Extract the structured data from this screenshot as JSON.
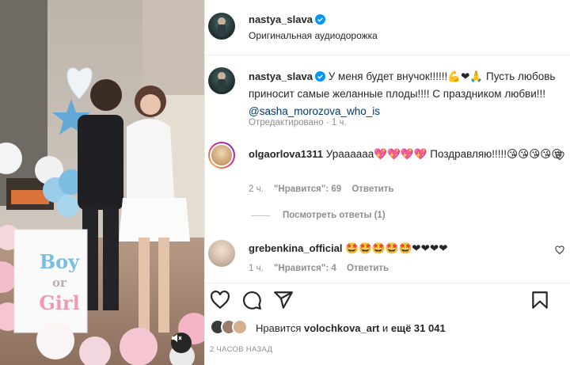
{
  "post": {
    "author": "nastya_slava",
    "audio": "Оригинальная аудиодорожка"
  },
  "caption": {
    "author": "nastya_slava",
    "text_1": "У меня будет внучок!!!!!!",
    "emojis_1": "💪❤🙏",
    "text_2": "Пусть любовь приносит самые желанные плоды!!!! С праздником любви!!!",
    "mention": "@sasha_morozova_who_is",
    "edited": "Отредактировано",
    "time": "1 ч."
  },
  "comments": [
    {
      "author": "olgaorlova1311",
      "text_before": "Ураааааа",
      "emojis_1": "💖💖💖💖",
      "text_after": "Поздравляю!!!!!",
      "emojis_2": "😘😘😘😘😘",
      "time": "2 ч.",
      "likes": "\"Нравится\": 69",
      "reply": "Ответить",
      "view_replies": "Посмотреть ответы (1)"
    },
    {
      "author": "grebenkina_official",
      "emojis": "🤩🤩🤩🤩🤩❤❤❤❤",
      "time": "1 ч.",
      "likes": "\"Нравится\": 4",
      "reply": "Ответить"
    }
  ],
  "likes": {
    "prefix": "Нравится",
    "user": "volochkova_art",
    "middle": "и",
    "others": "ещё 31 041"
  },
  "date": "2 ЧАСОВ НАЗАД",
  "media": {
    "box_text_1": "Boy",
    "box_text_2": "or",
    "box_text_3": "Girl"
  },
  "colors": {
    "verified": "#0095f6",
    "mention": "#00376b",
    "muted": "#8e8e8e",
    "heart_red": "#ed4956"
  },
  "icons": [
    "heart-icon",
    "comment-icon",
    "share-icon",
    "bookmark-icon",
    "sound-off-icon",
    "verified-icon"
  ]
}
